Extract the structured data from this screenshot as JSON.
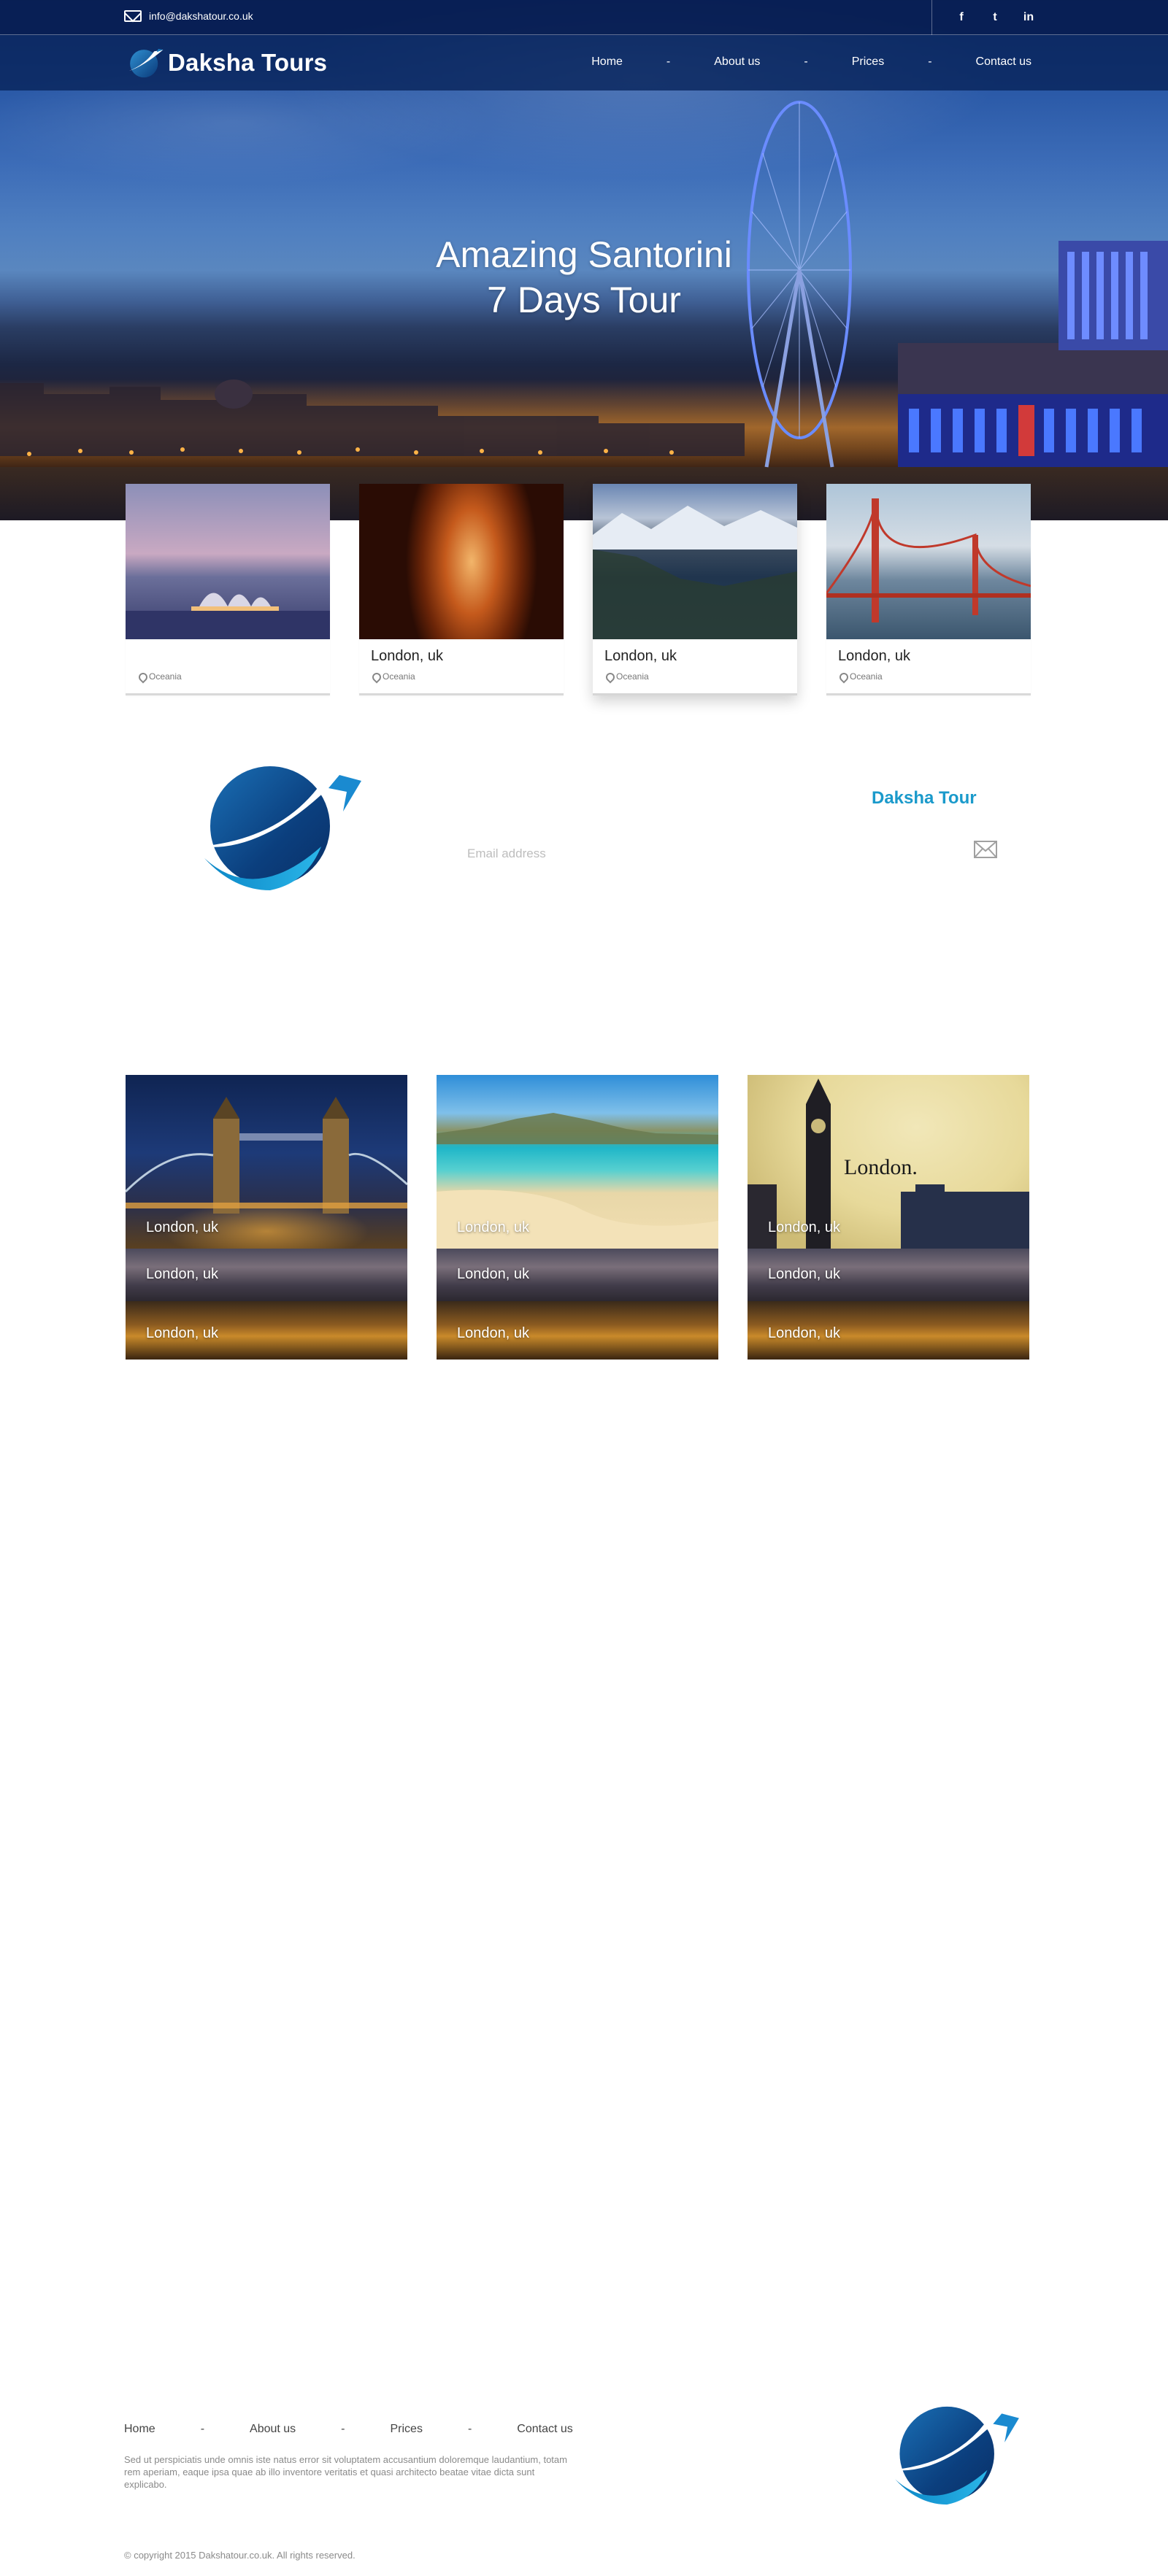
{
  "header": {
    "email": "info@dakshatour.co.uk",
    "social": [
      {
        "icon": "facebook-icon",
        "glyph": "f"
      },
      {
        "icon": "twitter-icon",
        "glyph": "t"
      },
      {
        "icon": "linkedin-icon",
        "glyph": "in"
      }
    ],
    "brand": "Daksha Tours",
    "nav": [
      "Home",
      "About us",
      "Prices",
      "Contact us"
    ],
    "nav_separator": "-"
  },
  "hero": {
    "title_line1": "Amazing Santorini",
    "title_line2": "7 Days Tour"
  },
  "cards": [
    {
      "title": "",
      "location": "Oceania",
      "image": "sydney-opera-house"
    },
    {
      "title": "London, uk",
      "location": "Oceania",
      "image": "antelope-canyon"
    },
    {
      "title": "London, uk",
      "location": "Oceania",
      "image": "lake-mountains"
    },
    {
      "title": "London, uk",
      "location": "Oceania",
      "image": "golden-gate-bridge"
    }
  ],
  "newsletter": {
    "title": "Daksha Tour",
    "placeholder": "Email address"
  },
  "gallery": [
    {
      "image": "tower-bridge",
      "labels": [
        "London, uk",
        "London, uk",
        "London, uk"
      ]
    },
    {
      "image": "beach",
      "labels": [
        "London, uk",
        "London, uk",
        "London, uk"
      ]
    },
    {
      "image": "big-ben",
      "overlay_text": "London.",
      "labels": [
        "London, uk",
        "London, uk",
        "London, uk"
      ]
    }
  ],
  "footer": {
    "nav": [
      "Home",
      "About us",
      "Prices",
      "Contact us"
    ],
    "nav_separator": "-",
    "text": "Sed ut perspiciatis unde omnis iste natus error sit voluptatem accusantium doloremque laudantium, totam rem aperiam, eaque ipsa quae ab illo inventore veritatis et quasi architecto beatae vitae dicta sunt explicabo.",
    "copyright": "© copyright 2015 Dakshatour.co.uk. All rights reserved."
  },
  "colors": {
    "navy": "#0a2a6e",
    "accent": "#1a9acb"
  }
}
